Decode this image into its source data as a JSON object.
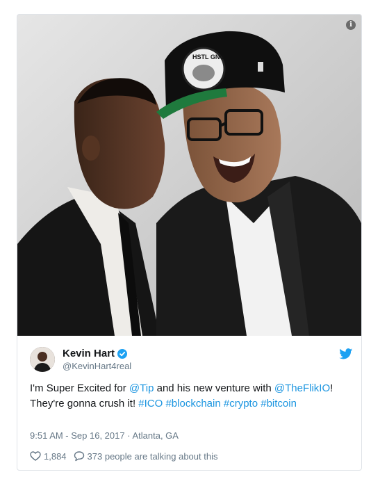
{
  "media": {
    "cap_text": "HSTL GNG",
    "info_icon": "info-icon"
  },
  "user": {
    "display_name": "Kevin Hart",
    "handle": "@KevinHart4real",
    "verified_icon": "verified-badge-icon",
    "avatar_icon": "avatar"
  },
  "tweet": {
    "segments": [
      {
        "text": "I'm Super Excited for ",
        "link": false
      },
      {
        "text": "@Tip",
        "link": true
      },
      {
        "text": " and his new venture with ",
        "link": false
      },
      {
        "text": "@TheFlikIO",
        "link": true
      },
      {
        "text": "! They're gonna crush it!  ",
        "link": false
      },
      {
        "text": "#ICO",
        "link": true
      },
      {
        "text": " ",
        "link": false
      },
      {
        "text": "#blockchain",
        "link": true
      },
      {
        "text": " ",
        "link": false
      },
      {
        "text": "#crypto",
        "link": true
      },
      {
        "text": " ",
        "link": false
      },
      {
        "text": "#bitcoin",
        "link": true
      }
    ],
    "timestamp": "9:51 AM - Sep 16, 2017",
    "location": "Atlanta, GA",
    "likes": "1,884",
    "talking": "373 people are talking about this"
  },
  "colors": {
    "link": "#1b95e0",
    "secondary": "#657786",
    "twitter_blue": "#1da1f2"
  },
  "icons": {
    "brand": "twitter-bird-icon",
    "like": "heart-icon",
    "reply": "speech-bubble-icon"
  }
}
